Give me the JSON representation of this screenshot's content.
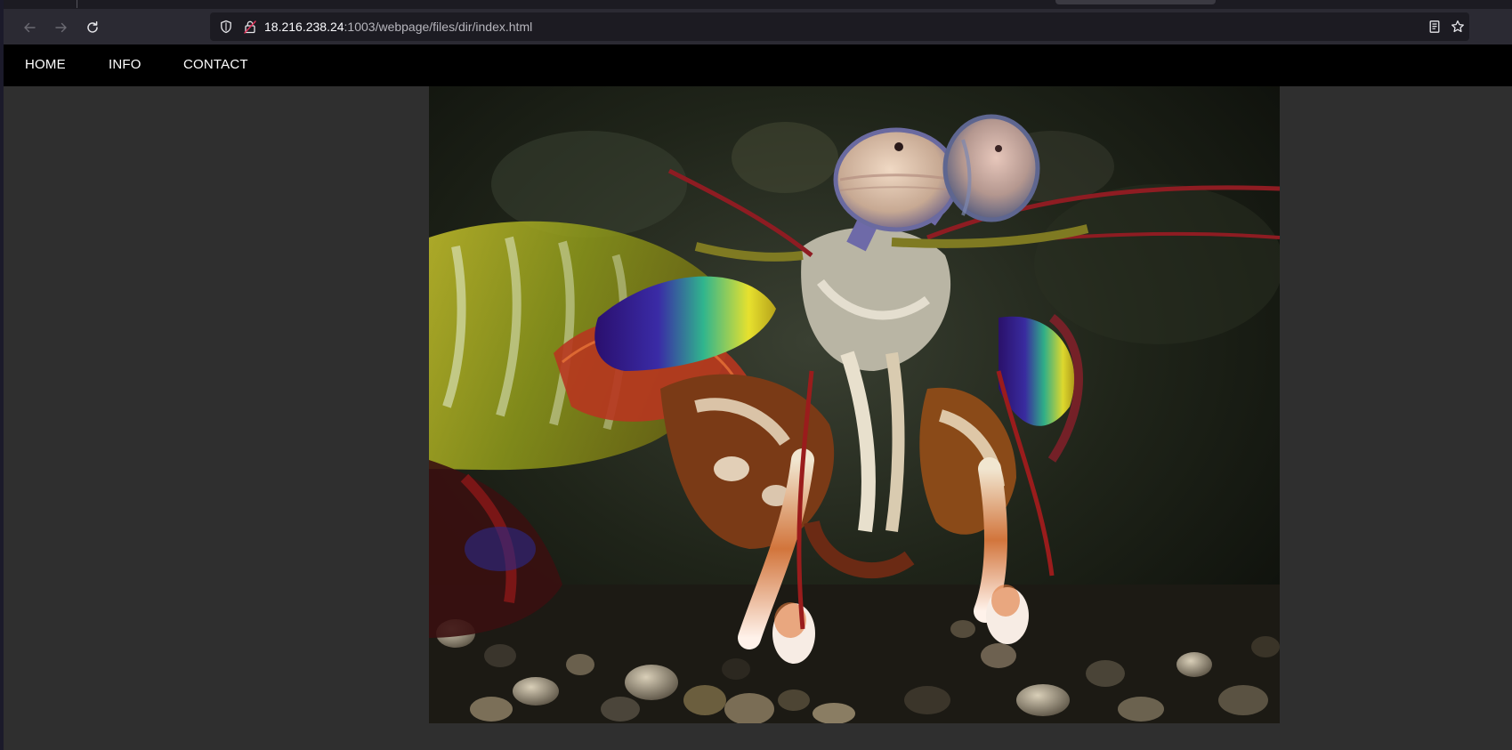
{
  "browser": {
    "url_host": "18.216.238.24",
    "url_rest": ":1003/webpage/files/dir/index.html",
    "icons": [
      "back-arrow-icon",
      "forward-arrow-icon",
      "reload-icon",
      "shield-icon",
      "lock-icon",
      "reader-view-icon",
      "star-icon"
    ]
  },
  "site": {
    "nav": [
      {
        "label": "HOME"
      },
      {
        "label": "INFO"
      },
      {
        "label": "CONTACT"
      }
    ],
    "background_color": "#2f2f2f",
    "nav_background_color": "#000000"
  }
}
